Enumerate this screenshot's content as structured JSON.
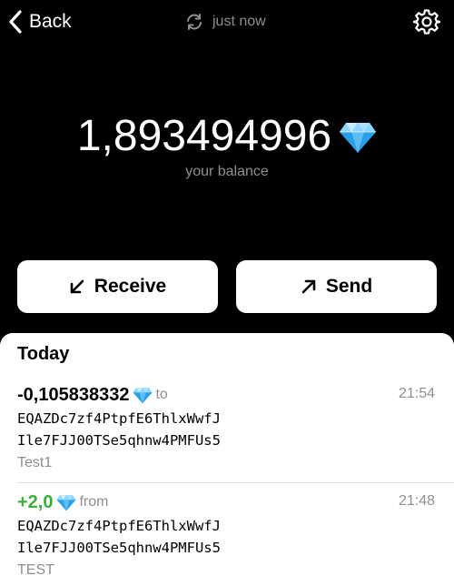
{
  "header": {
    "back_label": "Back",
    "sync_status": "just now",
    "icons": {
      "back": "chevron-left-icon",
      "sync": "refresh-icon",
      "settings": "gear-icon"
    }
  },
  "wallet": {
    "balance": "1,893494996",
    "balance_caption": "your balance",
    "currency_icon": "diamond-icon"
  },
  "actions": {
    "receive_label": "Receive",
    "send_label": "Send"
  },
  "history": {
    "section_title": "Today",
    "transactions": [
      {
        "amount": "-0,105838332",
        "direction": "to",
        "time": "21:54",
        "address_line1": "EQAZDc7zf4PtpfE6ThlxWwfJ",
        "address_line2": "Ile7FJJ00TSe5qhnw4PMFUs5",
        "comment": "Test1",
        "type": "outgoing"
      },
      {
        "amount": "+2,0",
        "direction": "from",
        "time": "21:48",
        "address_line1": "EQAZDc7zf4PtpfE6ThlxWwfJ",
        "address_line2": "Ile7FJJ00TSe5qhnw4PMFUs5",
        "comment": "TEST",
        "type": "incoming"
      }
    ]
  },
  "colors": {
    "background": "#000000",
    "sheet": "#ffffff",
    "secondary_text": "#8e8e93",
    "incoming_amount": "#3aae3a",
    "gem_light": "#8fd6ff",
    "gem_dark": "#2a9fe8"
  }
}
